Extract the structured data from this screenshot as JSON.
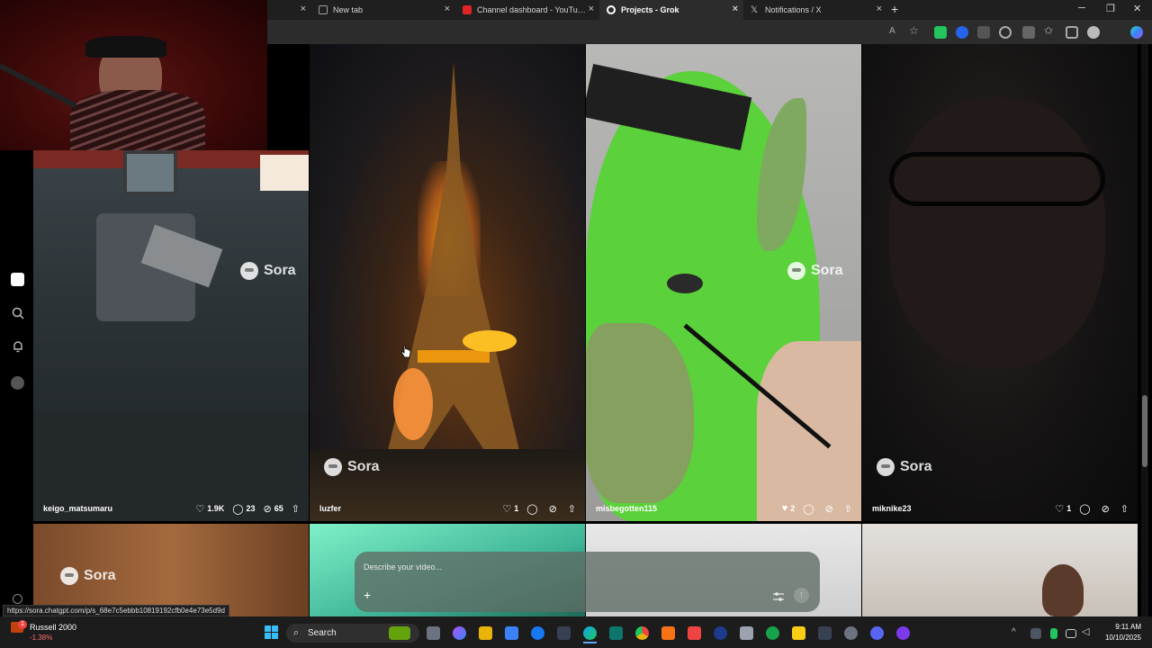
{
  "browser": {
    "tabs": [
      {
        "label": "New tab",
        "color": "#9aa0a6",
        "active": false
      },
      {
        "label": "Channel dashboard - YouTube Studio",
        "color": "#e02424",
        "active": false
      },
      {
        "label": "Projects - Grok",
        "color": "#ffffff",
        "active": true
      },
      {
        "label": "Notifications / X",
        "color": "#cfcfcf",
        "active": false
      }
    ],
    "new_tab": "+",
    "win_min": "─",
    "win_max": "❐",
    "win_close": "✕",
    "close_glyph": "×"
  },
  "feed": {
    "watermark": "Sora",
    "tiles": [
      {
        "user": "keigo_matsumaru",
        "likes": "1.9K",
        "comments": "23",
        "remixes": "65"
      },
      {
        "user": "luzfer",
        "likes": "1",
        "comments": "",
        "remixes": ""
      },
      {
        "user": "misbegotten115",
        "likes": "2",
        "comments": "",
        "remixes": ""
      },
      {
        "user": "miknike23",
        "likes": "1",
        "comments": "",
        "remixes": ""
      }
    ]
  },
  "prompt": {
    "placeholder": "Describe your video...",
    "add": "+",
    "submit": "↑"
  },
  "status_url": "https://sora.chatgpt.com/p/s_68e7c5ebbb10819192cfb0e4e73e5d9d",
  "taskbar": {
    "stock_name": "Russell 2000",
    "stock_change": "-1.38%",
    "stock_badge": "1",
    "search": "Search",
    "time": "9:11 AM",
    "date": "10/10/2025"
  }
}
